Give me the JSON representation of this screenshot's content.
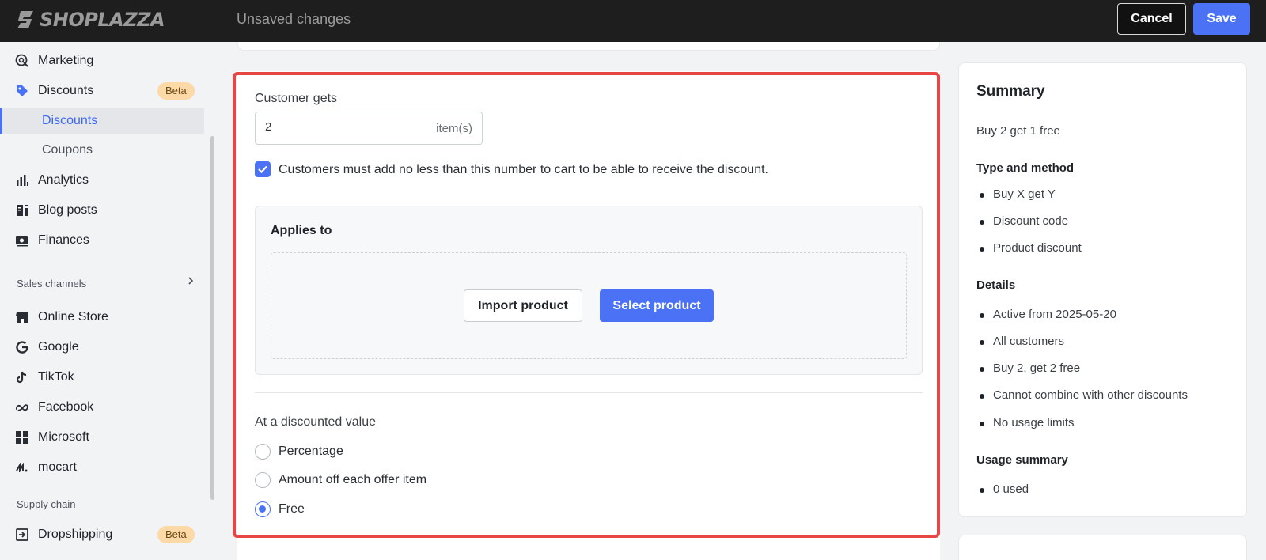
{
  "topbar": {
    "brand": "SHOPLAZZA",
    "status": "Unsaved changes",
    "cancel_label": "Cancel",
    "save_label": "Save"
  },
  "sidebar": {
    "items": [
      {
        "label": "Marketing",
        "icon": "marketing-icon"
      },
      {
        "label": "Discounts",
        "icon": "discount-tag-icon",
        "badge": "Beta"
      },
      {
        "label": "Discounts",
        "active": true
      },
      {
        "label": "Coupons"
      },
      {
        "label": "Analytics",
        "icon": "bar-chart-icon"
      },
      {
        "label": "Blog posts",
        "icon": "blog-icon"
      },
      {
        "label": "Finances",
        "icon": "finances-icon"
      }
    ],
    "sales_channels_label": "Sales channels",
    "channels": [
      {
        "label": "Online Store",
        "icon": "store-icon"
      },
      {
        "label": "Google",
        "icon": "google-icon"
      },
      {
        "label": "TikTok",
        "icon": "tiktok-icon"
      },
      {
        "label": "Facebook",
        "icon": "meta-icon"
      },
      {
        "label": "Microsoft",
        "icon": "microsoft-icon"
      },
      {
        "label": "mocart",
        "icon": "mocart-icon"
      }
    ],
    "supply_chain_label": "Supply chain",
    "supply": [
      {
        "label": "Dropshipping",
        "icon": "dropshipping-icon",
        "badge": "Beta"
      }
    ]
  },
  "form": {
    "customer_gets_label": "Customer gets",
    "quantity_value": "2",
    "quantity_suffix": "item(s)",
    "min_checkbox_label": "Customers must add no less than this number to cart to be able to receive the discount.",
    "min_checkbox_checked": true,
    "applies_to_title": "Applies to",
    "import_label": "Import product",
    "select_label": "Select product",
    "discounted_value_label": "At a discounted value",
    "options": [
      {
        "label": "Percentage",
        "selected": false
      },
      {
        "label": "Amount off each offer item",
        "selected": false
      },
      {
        "label": "Free",
        "selected": true
      }
    ]
  },
  "summary": {
    "title": "Summary",
    "subtitle": "Buy 2 get 1 free",
    "type_heading": "Type and method",
    "type_items": [
      "Buy X get Y",
      "Discount code",
      "Product discount"
    ],
    "details_heading": "Details",
    "details_items": [
      "Active from 2025-05-20",
      "All customers",
      "Buy 2, get 2 free",
      "Cannot combine with other discounts",
      "No usage limits"
    ],
    "usage_heading": "Usage summary",
    "usage_items": [
      "0 used"
    ]
  },
  "colors": {
    "accent": "#4b72f5",
    "highlight": "#e84545",
    "badge": "#fcd9a6"
  }
}
